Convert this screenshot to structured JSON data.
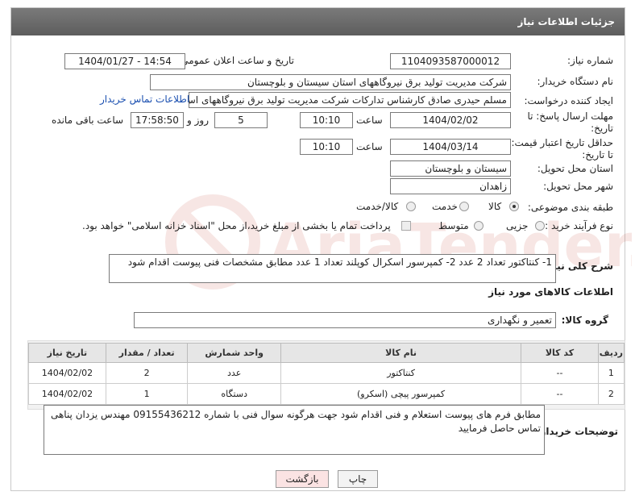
{
  "window": {
    "title": "جزئیات اطلاعات نیاز"
  },
  "fields": {
    "need_number_label": "شماره نیاز:",
    "need_number": "1104093587000012",
    "announce_label": "تاریخ و ساعت اعلان عمومی:",
    "announce_value": "1404/01/27 - 14:54",
    "buyer_org_label": "نام دستگاه خریدار:",
    "buyer_org": "شرکت مدیریت تولید برق نیروگاههای استان سیستان و بلوچستان",
    "requester_label": "ایجاد کننده درخواست:",
    "requester": "مسلم حیدری صادق کارشناس تدارکات شرکت مدیریت تولید برق نیروگاههای اس",
    "buyer_contact_link": "اطلاعات تماس خریدار",
    "deadline_label_1": "مهلت ارسال پاسخ: تا",
    "deadline_label_2": "تاریخ:",
    "deadline_date": "1404/02/02",
    "time_label": "ساعت",
    "deadline_time": "10:10",
    "days_value": "5",
    "days_label": "روز و",
    "remaining_time": "17:58:50",
    "remaining_label": "ساعت باقی مانده",
    "price_valid_label_1": "حداقل تاریخ اعتبار قیمت:",
    "price_valid_label_2": "تا تاریخ:",
    "price_valid_date": "1404/03/14",
    "price_valid_time": "10:10",
    "province_label": "استان محل تحویل:",
    "province": "سیستان و بلوچستان",
    "city_label": "شهر محل تحویل:",
    "city": "زاهدان",
    "category_label": "طبقه بندی موضوعی:",
    "category_options": [
      "کالا",
      "خدمت",
      "کالا/خدمت"
    ],
    "process_label": "نوع فرآیند خرید :",
    "process_options": [
      "جزیی",
      "متوسط"
    ],
    "payment_note": "پرداخت تمام یا بخشی از مبلغ خرید،از محل \"اسناد خزانه اسلامی\" خواهد بود.",
    "description_label": "شرح کلی نیاز:",
    "description": "1- کنتاکتور  تعداد  2 عدد  2- کمپرسور  اسکرال کوپلند  تعداد 1 عدد  مطابق مشخصات فنی پیوست اقدام شود"
  },
  "goods": {
    "section_title": "اطلاعات کالاهای مورد نیاز",
    "group_label": "گروه کالا:",
    "group_value": "تعمیر و نگهداری",
    "columns": [
      "ردیف",
      "کد کالا",
      "نام کالا",
      "واحد شمارش",
      "تعداد / مقدار",
      "تاریخ نیاز"
    ],
    "rows": [
      {
        "row": "1",
        "code": "--",
        "name": "کنتاکتور",
        "unit": "عدد",
        "qty": "2",
        "date": "1404/02/02"
      },
      {
        "row": "2",
        "code": "--",
        "name": "کمپرسور پیچی (اسکرو)",
        "unit": "دستگاه",
        "qty": "1",
        "date": "1404/02/02"
      }
    ]
  },
  "buyer_notes": {
    "label": "توضیحات خریدار:",
    "text": "مطابق فرم های پیوست استعلام و فنی اقدام شود جهت هرگونه سوال فنی با شماره 09155436212 مهندس یزدان پناهی تماس حاصل فرمایید"
  },
  "buttons": {
    "print": "چاپ",
    "back": "بازگشت"
  },
  "watermark": {
    "text": "AriaTender.neT",
    "color": "#c0392b"
  }
}
